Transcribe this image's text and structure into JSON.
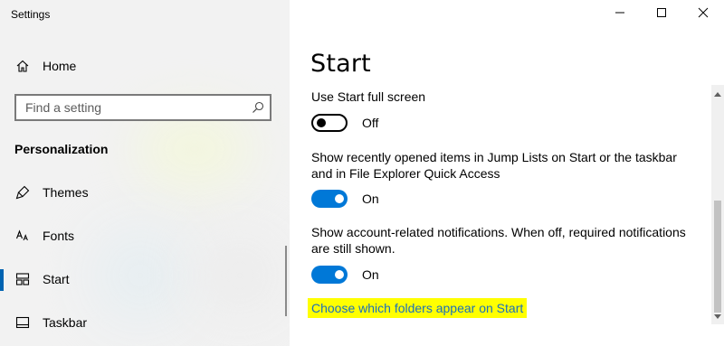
{
  "window": {
    "title": "Settings",
    "controls": {
      "minimize": "minimize-icon",
      "maximize": "maximize-icon",
      "close": "close-icon"
    }
  },
  "sidebar": {
    "home_label": "Home",
    "search_placeholder": "Find a setting",
    "section_title": "Personalization",
    "items": [
      {
        "label": "Themes",
        "icon": "themes-icon"
      },
      {
        "label": "Fonts",
        "icon": "fonts-icon"
      },
      {
        "label": "Start",
        "icon": "start-icon",
        "selected": true
      },
      {
        "label": "Taskbar",
        "icon": "taskbar-icon"
      }
    ]
  },
  "main": {
    "title": "Start",
    "settings": [
      {
        "label": "Use Start full screen",
        "state": "Off",
        "on": false
      },
      {
        "label": "Show recently opened items in Jump Lists on Start or the taskbar and in File Explorer Quick Access",
        "state": "On",
        "on": true
      },
      {
        "label": "Show account-related notifications. When off, required notifications are still shown.",
        "state": "On",
        "on": true
      }
    ],
    "link_text": "Choose which folders appear on Start"
  },
  "colors": {
    "accent": "#0078d7",
    "link": "#1a6fbd",
    "highlight": "#ffff00",
    "selection_bar": "#0063b1"
  }
}
